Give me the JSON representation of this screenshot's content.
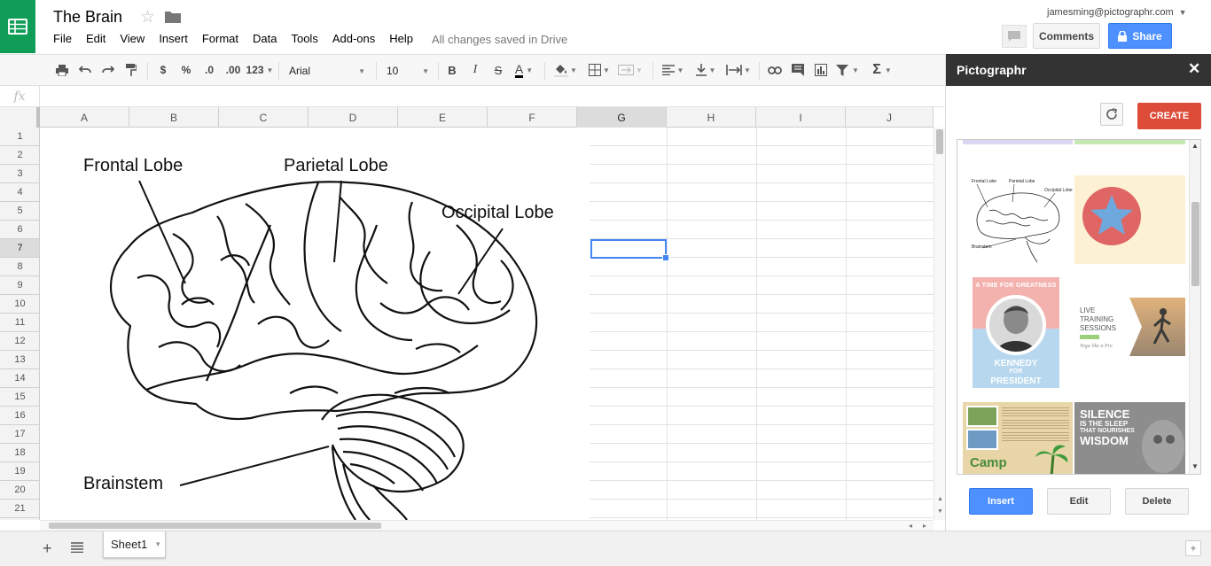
{
  "app": {
    "title": "The Brain",
    "saved_status": "All changes saved in Drive",
    "user_email": "jamesming@pictographr.com",
    "comments_label": "Comments",
    "share_label": "Share"
  },
  "menu": [
    "File",
    "Edit",
    "View",
    "Insert",
    "Format",
    "Data",
    "Tools",
    "Add-ons",
    "Help"
  ],
  "toolbar": {
    "font": "Arial",
    "font_size": "10",
    "currency": "$",
    "percent": "%",
    "decrease_decimal": ".0",
    "increase_decimal": ".00",
    "number_format": "123",
    "bold": "B",
    "italic": "I",
    "strikethrough": "S",
    "text_color": "A",
    "sum": "Σ"
  },
  "formula_bar": {
    "fx": "fx",
    "value": ""
  },
  "columns": [
    "A",
    "B",
    "C",
    "D",
    "E",
    "F",
    "G",
    "H",
    "I",
    "J"
  ],
  "selected_column": "G",
  "rows": [
    "1",
    "2",
    "3",
    "4",
    "5",
    "6",
    "7",
    "8",
    "9",
    "10",
    "11",
    "12",
    "13",
    "14",
    "15",
    "16",
    "17",
    "18",
    "19",
    "20",
    "21"
  ],
  "selected_row": "7",
  "image_labels": {
    "frontal": "Frontal Lobe",
    "parietal": "Parietal Lobe",
    "occipital": "Occipital Lobe",
    "brainstem": "Brainstem"
  },
  "sheet_tabs": {
    "active": "Sheet1"
  },
  "sidebar": {
    "title": "Pictographr",
    "create_label": "CREATE",
    "insert_label": "Insert",
    "edit_label": "Edit",
    "delete_label": "Delete",
    "thumb_kennedy_top": "A TIME FOR GREATNESS",
    "thumb_kennedy_bottom_1": "KENNEDY",
    "thumb_kennedy_bottom_2": "FOR",
    "thumb_kennedy_bottom_3": "PRESIDENT",
    "thumb_training_1": "LIVE",
    "thumb_training_2": "TRAINING",
    "thumb_training_3": "SESSIONS",
    "thumb_training_sig": "Yoga like a Pro",
    "thumb_camp": "Camp",
    "thumb_silence_1": "SILENCE",
    "thumb_silence_2": "IS THE SLEEP",
    "thumb_silence_3": "THAT NOURISHES",
    "thumb_silence_4": "WISDOM",
    "thumb_brain_frontal": "Frontal Lobe",
    "thumb_brain_parietal": "Parietal Lobe",
    "thumb_brain_occipital": "Occipital Lobe",
    "thumb_brain_brainstem": "Brainstem"
  },
  "colors": {
    "sheets_green": "#0f9d58",
    "share_blue": "#4d90fe",
    "create_red": "#dd4b39",
    "sidebar_header": "#333333",
    "selection_blue": "#4285f4"
  }
}
